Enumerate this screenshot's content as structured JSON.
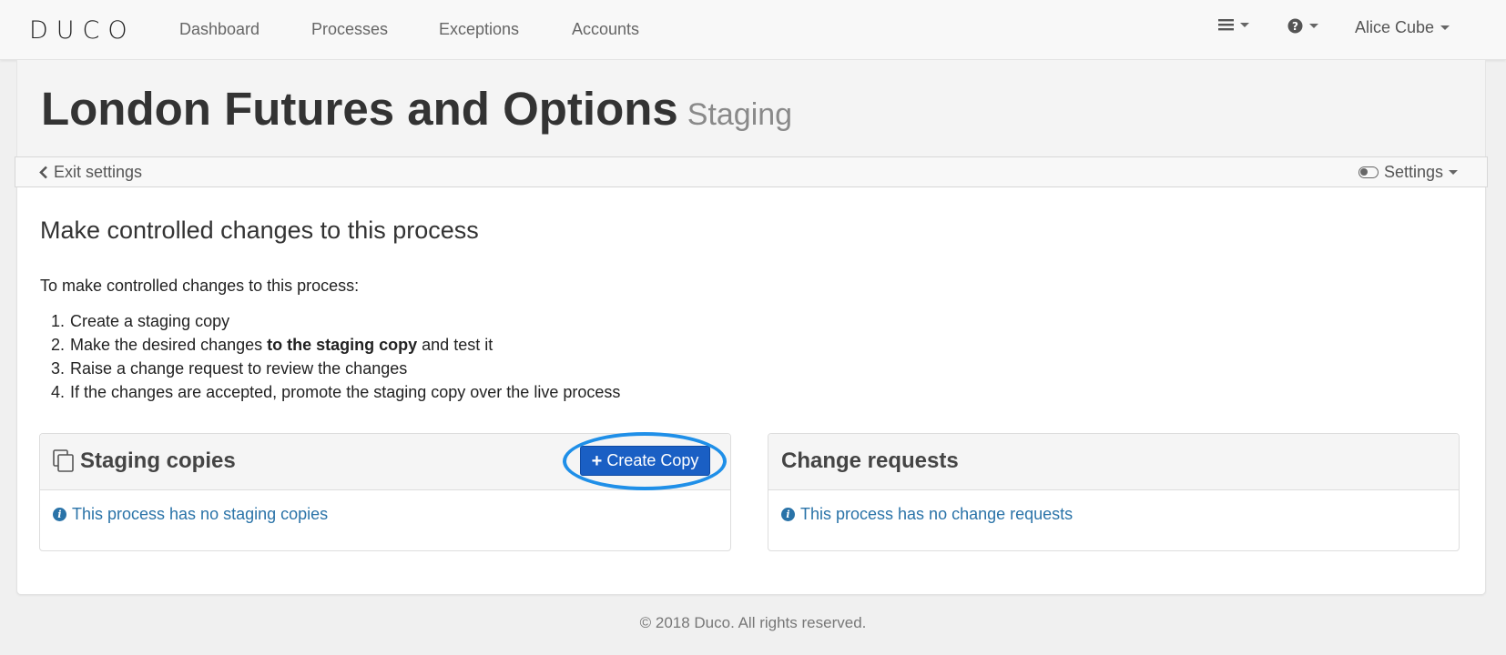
{
  "navbar": {
    "logo": "DUCO",
    "links": [
      "Dashboard",
      "Processes",
      "Exceptions",
      "Accounts"
    ],
    "menu_icon": "hamburger-menu-icon",
    "help_icon": "question-circle-icon",
    "user_name": "Alice Cube"
  },
  "header": {
    "title": "London Futures and Options",
    "subtitle": "Staging"
  },
  "subbar": {
    "exit_label": "Exit settings",
    "settings_label": "Settings"
  },
  "main": {
    "section_title": "Make controlled changes to this process",
    "intro": "To make controlled changes to this process:",
    "steps": [
      {
        "num": "1.",
        "text": "Create a staging copy"
      },
      {
        "num": "2.",
        "text_before": "Make the desired changes ",
        "text_bold": "to the staging copy",
        "text_after": " and test it"
      },
      {
        "num": "3.",
        "text": "Raise a change request to review the changes"
      },
      {
        "num": "4.",
        "text": "If the changes are accepted, promote the staging copy over the live process"
      }
    ]
  },
  "staging_panel": {
    "title": "Staging copies",
    "button_label": "Create Copy",
    "empty_message": "This process has no staging copies"
  },
  "change_panel": {
    "title": "Change requests",
    "empty_message": "This process has no change requests"
  },
  "footer": {
    "copyright": "© 2018 Duco. All rights reserved."
  },
  "colors": {
    "primary_button": "#1a5fc4",
    "link": "#2a73a8",
    "highlight_ring": "#1f8fe8"
  }
}
